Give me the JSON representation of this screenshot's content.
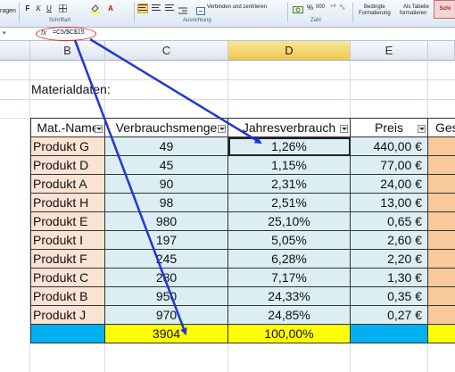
{
  "ribbon": {
    "left_cut_label": "ragen",
    "bold": "F",
    "italic": "K",
    "underline": "U",
    "merge_label": "Verbinden und zentrieren",
    "number_format_percent": "%",
    "number_format_thousands": "000",
    "groups": {
      "font": "Schriftart",
      "alignment": "Ausrichtung",
      "number": "Zahl"
    },
    "cond_format_line1": "Bedingte",
    "cond_format_line2": "Formatierung",
    "as_table_line1": "Als Tabelle",
    "as_table_line2": "formatieren",
    "styles_cut": "Schi"
  },
  "formula_bar": {
    "fx": "fx",
    "formula": "=C5/$C$15",
    "annotation_color": "#e3232a"
  },
  "columns": [
    "B",
    "C",
    "D",
    "E"
  ],
  "active_column": "D",
  "section_title": "Materialdaten:",
  "table": {
    "headers": [
      "Mat.-Name",
      "Verbrauchsmenge",
      "Jahresverbrauch",
      "Preis",
      "Ges"
    ],
    "rows": [
      {
        "name": "Produkt G",
        "qty": "49",
        "pct": "1,26%",
        "price": "440,00 €"
      },
      {
        "name": "Produkt D",
        "qty": "45",
        "pct": "1,15%",
        "price": "77,00 €"
      },
      {
        "name": "Produkt A",
        "qty": "90",
        "pct": "2,31%",
        "price": "24,00 €"
      },
      {
        "name": "Produkt H",
        "qty": "98",
        "pct": "2,51%",
        "price": "13,00 €"
      },
      {
        "name": "Produkt E",
        "qty": "980",
        "pct": "25,10%",
        "price": "0,65 €"
      },
      {
        "name": "Produkt I",
        "qty": "197",
        "pct": "5,05%",
        "price": "2,60 €"
      },
      {
        "name": "Produkt F",
        "qty": "245",
        "pct": "6,28%",
        "price": "2,20 €"
      },
      {
        "name": "Produkt C",
        "qty": "280",
        "pct": "7,17%",
        "price": "1,30 €"
      },
      {
        "name": "Produkt B",
        "qty": "950",
        "pct": "24,33%",
        "price": "0,35 €"
      },
      {
        "name": "Produkt J",
        "qty": "970",
        "pct": "24,85%",
        "price": "0,27 €"
      }
    ],
    "totals": {
      "qty": "3904",
      "pct": "100,00%"
    }
  },
  "colors": {
    "name_fill": "#fbe3d4",
    "value_fill": "#dbeef4",
    "total_fill": "#ffff00",
    "total_blue": "#00b0f0",
    "ges_fill": "#f8c99a",
    "arrow": "#1f36d6"
  }
}
